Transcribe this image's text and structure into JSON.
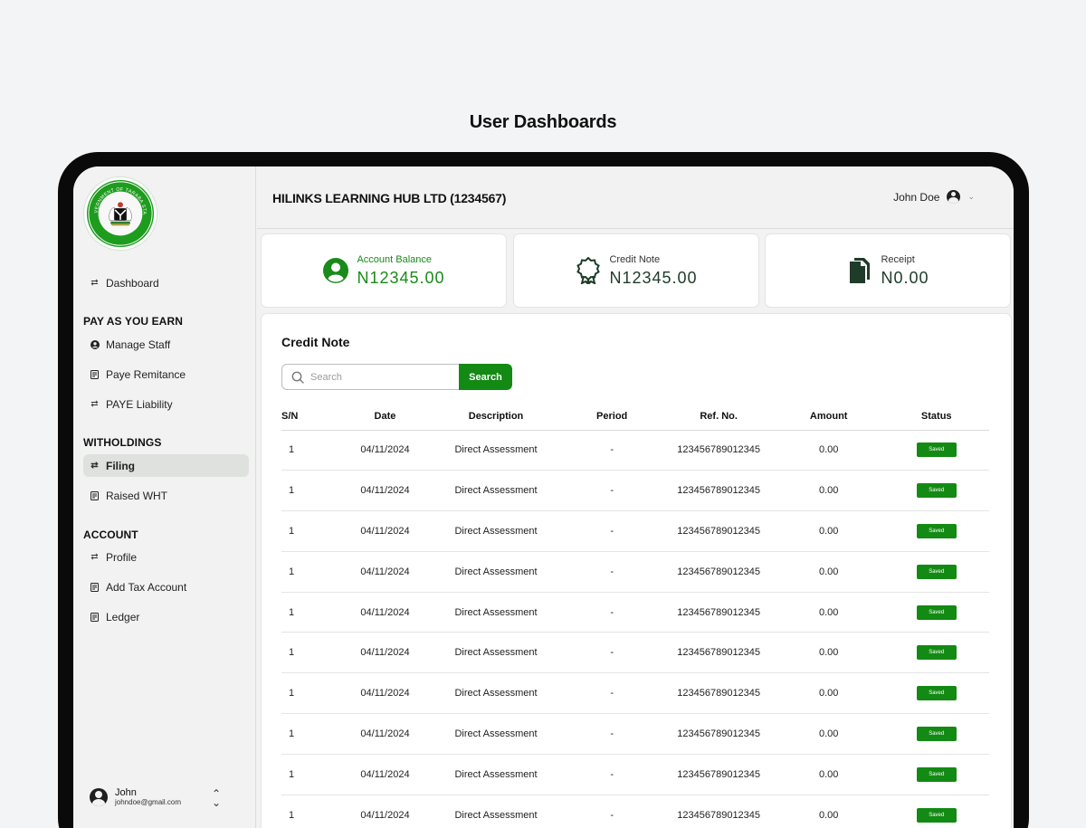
{
  "page": {
    "heading": "User Dashboards"
  },
  "sidebar": {
    "dashboard": "Dashboard",
    "sections": {
      "paye": "PAY AS YOU EARN",
      "withholdings": "WITHOLDINGS",
      "account": "ACCOUNT"
    },
    "items": {
      "manage_staff": "Manage Staff",
      "paye_remitance": "Paye Remitance",
      "paye_liability": "PAYE Liability",
      "filing": "Filing",
      "raised_wht": "Raised WHT",
      "profile": "Profile",
      "add_tax_account": "Add Tax Account",
      "ledger": "Ledger"
    },
    "active_item": "Filing",
    "user": {
      "name": "John",
      "email": "johndoe@gmail.com"
    }
  },
  "header": {
    "company": "HILINKS LEARNING HUB LTD (1234567)",
    "user_name": "John Doe"
  },
  "cards": [
    {
      "label": "Account Balance",
      "value": "N12345.00",
      "icon": "user-circle-icon",
      "accent": "#1a8a1a"
    },
    {
      "label": "Credit Note",
      "value": "N12345.00",
      "icon": "award-badge-icon",
      "accent": "#1f3b2a"
    },
    {
      "label": "Receipt",
      "value": "N0.00",
      "icon": "documents-icon",
      "accent": "#1f3b2a"
    }
  ],
  "credit_note": {
    "title": "Credit Note",
    "search_placeholder": "Search",
    "search_button": "Search",
    "columns": [
      "S/N",
      "Date",
      "Description",
      "Period",
      "Ref. No.",
      "Amount",
      "Status"
    ],
    "rows": [
      [
        "1",
        "04/11/2024",
        "Direct Assessment",
        "-",
        "123456789012345",
        "0.00",
        "Saved"
      ],
      [
        "1",
        "04/11/2024",
        "Direct Assessment",
        "-",
        "123456789012345",
        "0.00",
        "Saved"
      ],
      [
        "1",
        "04/11/2024",
        "Direct Assessment",
        "-",
        "123456789012345",
        "0.00",
        "Saved"
      ],
      [
        "1",
        "04/11/2024",
        "Direct Assessment",
        "-",
        "123456789012345",
        "0.00",
        "Saved"
      ],
      [
        "1",
        "04/11/2024",
        "Direct Assessment",
        "-",
        "123456789012345",
        "0.00",
        "Saved"
      ],
      [
        "1",
        "04/11/2024",
        "Direct Assessment",
        "-",
        "123456789012345",
        "0.00",
        "Saved"
      ],
      [
        "1",
        "04/11/2024",
        "Direct Assessment",
        "-",
        "123456789012345",
        "0.00",
        "Saved"
      ],
      [
        "1",
        "04/11/2024",
        "Direct Assessment",
        "-",
        "123456789012345",
        "0.00",
        "Saved"
      ],
      [
        "1",
        "04/11/2024",
        "Direct Assessment",
        "-",
        "123456789012345",
        "0.00",
        "Saved"
      ],
      [
        "1",
        "04/11/2024",
        "Direct Assessment",
        "-",
        "123456789012345",
        "0.00",
        "Saved"
      ]
    ]
  },
  "logo": {
    "top_text": "GOVERNMENT OF TARABA STATE",
    "bottom_text": "NIGERIA"
  },
  "colors": {
    "brand_green": "#138a13",
    "status_saved": "#138a13"
  }
}
